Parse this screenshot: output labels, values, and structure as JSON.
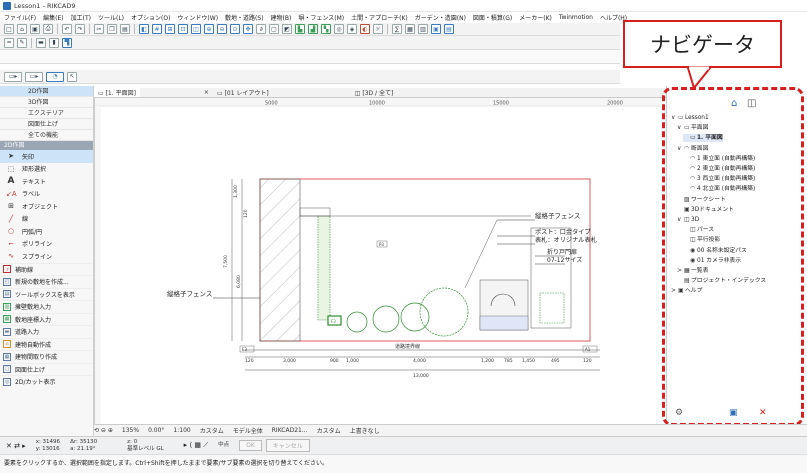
{
  "window": {
    "title": "Lesson1 - RIKCAD9"
  },
  "menu": [
    "ファイル(F)",
    "編集(E)",
    "加工(T)",
    "ツール(L)",
    "オプション(O)",
    "ウィンドウ(W)",
    "敷地・道路(S)",
    "建物(B)",
    "塀・フェンス(M)",
    "土間・アプローチ(K)",
    "ガーデン・造園(N)",
    "図面・積算(G)",
    "メーカー(K)",
    "Twinmotion",
    "ヘルプ(H)"
  ],
  "callout": {
    "text": "ナビゲータ",
    "border_color": "#d81e1e"
  },
  "toolbox": {
    "tabs": [
      "2D作図",
      "3D作図",
      "エクステリア",
      "図面仕上げ",
      "全ての機能"
    ],
    "section": "2D作図",
    "tools": [
      {
        "icon": "arrow",
        "label": "矢印"
      },
      {
        "icon": "rect-select",
        "label": "矩形選択"
      },
      {
        "icon": "A",
        "label": "テキスト"
      },
      {
        "icon": "A1",
        "label": "ラベル"
      },
      {
        "icon": "object",
        "label": "オブジェクト"
      },
      {
        "icon": "line",
        "label": "線"
      },
      {
        "icon": "circle",
        "label": "円弧/円"
      },
      {
        "icon": "polyline",
        "label": "ポリライン"
      },
      {
        "icon": "spline",
        "label": "スプライン"
      }
    ],
    "extra": [
      "補助線",
      "新規の敷地を作成...",
      "ツールボックスを表示",
      "擁壁敷地入力",
      "敷地座標入力",
      "道路入力",
      "建物自動作成",
      "建物間取り作成",
      "図面仕上げ",
      "2D/カット表示"
    ]
  },
  "tabs": [
    {
      "label": "[1. 平面図]",
      "close": "×"
    },
    {
      "label": "[01 レイアウト]"
    },
    {
      "label": "[3D / 全て]"
    }
  ],
  "ruler": {
    "marks": [
      "5000",
      "10000",
      "15000",
      "20000"
    ]
  },
  "drawing": {
    "labels": {
      "fence_left": "縦格子フェンス",
      "fence_right": "縦格子フェンス",
      "post": "ポスト：口金タイプ",
      "sign": "表札：オリジナル表札",
      "gate": "折り戸門扉",
      "gate_size": "07-12サイズ",
      "road_line": "道路境界線"
    },
    "dims_bottom": [
      "120",
      "3,000",
      "900",
      "1,000",
      "4,000",
      "1,200",
      "785",
      "1,450",
      "495",
      "120"
    ],
    "dim_total": "13,000",
    "dims_left": [
      "1,300",
      "120",
      "7,500",
      "6,080"
    ],
    "markers": [
      "P3",
      "F3",
      "E3",
      "A1",
      "A2"
    ]
  },
  "navigator": {
    "items": [
      {
        "level": 0,
        "toggle": "∨",
        "icon": "folder",
        "label": "Lesson1"
      },
      {
        "level": 1,
        "toggle": "∨",
        "icon": "plan",
        "label": "平面図"
      },
      {
        "level": 2,
        "toggle": "",
        "icon": "plan",
        "label": "1. 平面図",
        "selected": true
      },
      {
        "level": 1,
        "toggle": "∨",
        "icon": "elev",
        "label": "断面図"
      },
      {
        "level": 2,
        "toggle": "",
        "icon": "elev",
        "label": "1 東立面 (自動再構築)"
      },
      {
        "level": 2,
        "toggle": "",
        "icon": "elev",
        "label": "2 東立面 (自動再構築)"
      },
      {
        "level": 2,
        "toggle": "",
        "icon": "elev",
        "label": "3 西立面 (自動再構築)"
      },
      {
        "level": 2,
        "toggle": "",
        "icon": "elev",
        "label": "4 北立面 (自動再構築)"
      },
      {
        "level": 1,
        "toggle": "",
        "icon": "sheet",
        "label": "ワークシート"
      },
      {
        "level": 1,
        "toggle": "",
        "icon": "doc",
        "label": "3Dドキュメント"
      },
      {
        "level": 1,
        "toggle": "∨",
        "icon": "3d",
        "label": "3D"
      },
      {
        "level": 2,
        "toggle": "",
        "icon": "3d",
        "label": "パース"
      },
      {
        "level": 2,
        "toggle": "",
        "icon": "3d",
        "label": "平行投影"
      },
      {
        "level": 2,
        "toggle": "",
        "icon": "cam",
        "label": "00 名称未設定パス"
      },
      {
        "level": 2,
        "toggle": "",
        "icon": "cam",
        "label": "01 カメラ非表示"
      },
      {
        "level": 1,
        "toggle": ">",
        "icon": "list",
        "label": "一覧表"
      },
      {
        "level": 1,
        "toggle": "",
        "icon": "index",
        "label": "プロジェクト・インデックス"
      },
      {
        "level": 0,
        "toggle": ">",
        "icon": "help",
        "label": "ヘルプ"
      }
    ]
  },
  "statusbar": {
    "zoom": "135%",
    "angle": "0.00°",
    "scale": "1:100",
    "view": "カスタム",
    "model": "モデル全体",
    "layer": "RIKCAD21...",
    "custom2": "カスタム",
    "overwrite": "上書きなし"
  },
  "coords": {
    "x": "x: 31496",
    "y": "y: 13016",
    "dr": "Δr: 35130",
    "da": "a: 21.19°",
    "z": "z: 0",
    "ref": "基準レベル GL",
    "center": "中点",
    "ok": "OK",
    "cancel": "キャンセル"
  },
  "help": "要素をクリックするか、選択範囲を指定します。Ctrl+Shiftを押したままで要素/サブ要素の選択を切り替えてください。"
}
